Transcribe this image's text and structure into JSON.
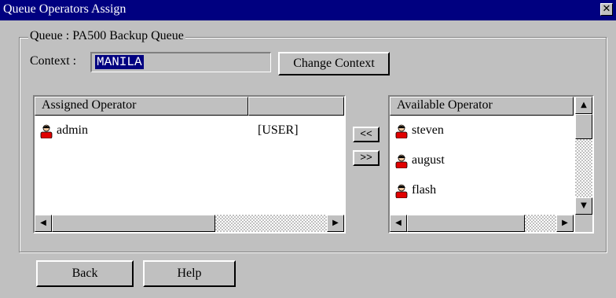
{
  "window": {
    "title": "Queue Operators Assign",
    "close_label": "✕"
  },
  "queue": {
    "group_label": "Queue : PA500 Backup Queue"
  },
  "context": {
    "label": "Context :",
    "value": "MANILA",
    "change_button": "Change Context"
  },
  "assigned": {
    "headers": [
      "Assigned Operator",
      ""
    ],
    "rows": [
      {
        "name": "admin",
        "type": "[USER]",
        "icon": "user-icon"
      }
    ]
  },
  "available": {
    "header": "Available Operator",
    "rows": [
      {
        "name": "steven",
        "icon": "user-icon"
      },
      {
        "name": "august",
        "icon": "user-icon"
      },
      {
        "name": "flash",
        "icon": "user-icon"
      }
    ]
  },
  "move": {
    "add_label": "<<",
    "remove_label": ">>"
  },
  "footer": {
    "back_label": "Back",
    "help_label": "Help"
  },
  "colors": {
    "titlebar": "#000080",
    "face": "#c0c0c0",
    "icon_red": "#e00000"
  }
}
